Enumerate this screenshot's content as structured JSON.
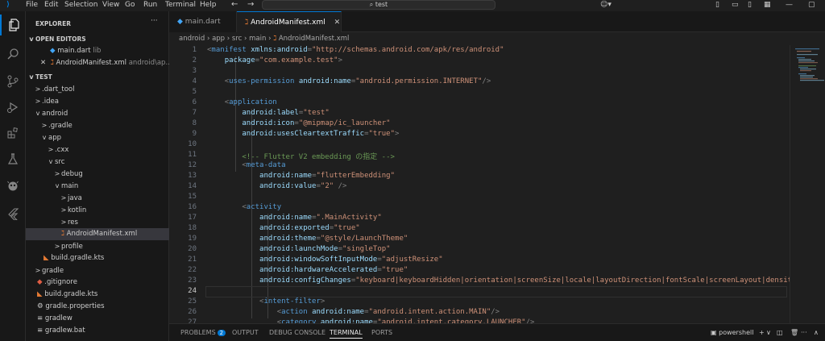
{
  "titlebar": {
    "menu": [
      "File",
      "Edit",
      "Selection",
      "View",
      "Go",
      "Run",
      "Terminal",
      "Help"
    ],
    "search_text": "test"
  },
  "activitybar": {
    "icons": [
      "files-icon",
      "search-icon",
      "source-control-icon",
      "run-debug-icon",
      "extensions-icon",
      "testing-icon",
      "flutter-devtools-icon",
      "flutter-icon"
    ]
  },
  "sidebar": {
    "title": "EXPLORER",
    "more": "···",
    "open_editors_label": "OPEN EDITORS",
    "open_editors": [
      {
        "name": "main.dart",
        "desc": "lib"
      },
      {
        "name": "AndroidManifest.xml",
        "desc": "android\\ap..."
      }
    ],
    "workspace_label": "TEST",
    "tree": [
      {
        "label": ".dart_tool",
        "chev": ">"
      },
      {
        "label": ".idea",
        "chev": ">"
      },
      {
        "label": "android",
        "chev": "v"
      },
      {
        "label": ".gradle",
        "chev": ">"
      },
      {
        "label": "app",
        "chev": "v"
      },
      {
        "label": ".cxx",
        "chev": ">"
      },
      {
        "label": "src",
        "chev": "v"
      },
      {
        "label": "debug",
        "chev": ">"
      },
      {
        "label": "main",
        "chev": "v"
      },
      {
        "label": "java",
        "chev": ">"
      },
      {
        "label": "kotlin",
        "chev": ">"
      },
      {
        "label": "res",
        "chev": ">"
      },
      {
        "label": "AndroidManifest.xml",
        "chev": ""
      },
      {
        "label": "profile",
        "chev": ">"
      },
      {
        "label": "build.gradle.kts",
        "chev": ""
      },
      {
        "label": "gradle",
        "chev": ">"
      },
      {
        "label": ".gitignore",
        "chev": ""
      },
      {
        "label": "build.gradle.kts",
        "chev": ""
      },
      {
        "label": "gradle.properties",
        "chev": ""
      },
      {
        "label": "gradlew",
        "chev": ""
      },
      {
        "label": "gradlew.bat",
        "chev": ""
      }
    ]
  },
  "tabs": [
    {
      "label": "main.dart",
      "active": false
    },
    {
      "label": "AndroidManifest.xml",
      "active": true
    }
  ],
  "breadcrumb": [
    "android",
    "app",
    "src",
    "main",
    "AndroidManifest.xml"
  ],
  "editor": {
    "current_line": 24,
    "line_numbers": [
      "1",
      "2",
      "3",
      "4",
      "5",
      "6",
      "7",
      "8",
      "9",
      "10",
      "11",
      "12",
      "13",
      "14",
      "15",
      "16",
      "17",
      "18",
      "19",
      "20",
      "21",
      "22",
      "23",
      "24",
      "25",
      "26",
      "27"
    ],
    "lines": [
      "<manifest xmlns:android=\"http://schemas.android.com/apk/res/android\"",
      "    package=\"com.example.test\">",
      "",
      "    <uses-permission android:name=\"android.permission.INTERNET\"/>",
      "",
      "    <application",
      "        android:label=\"test\"",
      "        android:icon=\"@mipmap/ic_launcher\"",
      "        android:usesCleartextTraffic=\"true\">",
      "",
      "        <!-- Flutter V2 embedding の指定 -->",
      "        <meta-data",
      "            android:name=\"flutterEmbedding\"",
      "            android:value=\"2\" />",
      "",
      "        <activity",
      "            android:name=\".MainActivity\"",
      "            android:exported=\"true\"",
      "            android:theme=\"@style/LaunchTheme\"",
      "            android:launchMode=\"singleTop\"",
      "            android:windowSoftInputMode=\"adjustResize\"",
      "            android:hardwareAccelerated=\"true\"",
      "            android:configChanges=\"keyboard|keyboardHidden|orientation|screenSize|locale|layoutDirection|fontScale|screenLayout|density|u",
      "",
      "            <intent-filter>",
      "                <action android:name=\"android.intent.action.MAIN\"/>",
      "                <category android:name=\"android.intent.category.LAUNCHER\"/>"
    ]
  },
  "panel": {
    "tabs": [
      "PROBLEMS",
      "OUTPUT",
      "DEBUG CONSOLE",
      "TERMINAL",
      "PORTS"
    ],
    "problems_count": "2",
    "active_tab": "TERMINAL",
    "terminal_name": "powershell"
  },
  "colors": {
    "accent": "#0078d4",
    "background": "#1f1f1f",
    "sidebar": "#181818"
  }
}
